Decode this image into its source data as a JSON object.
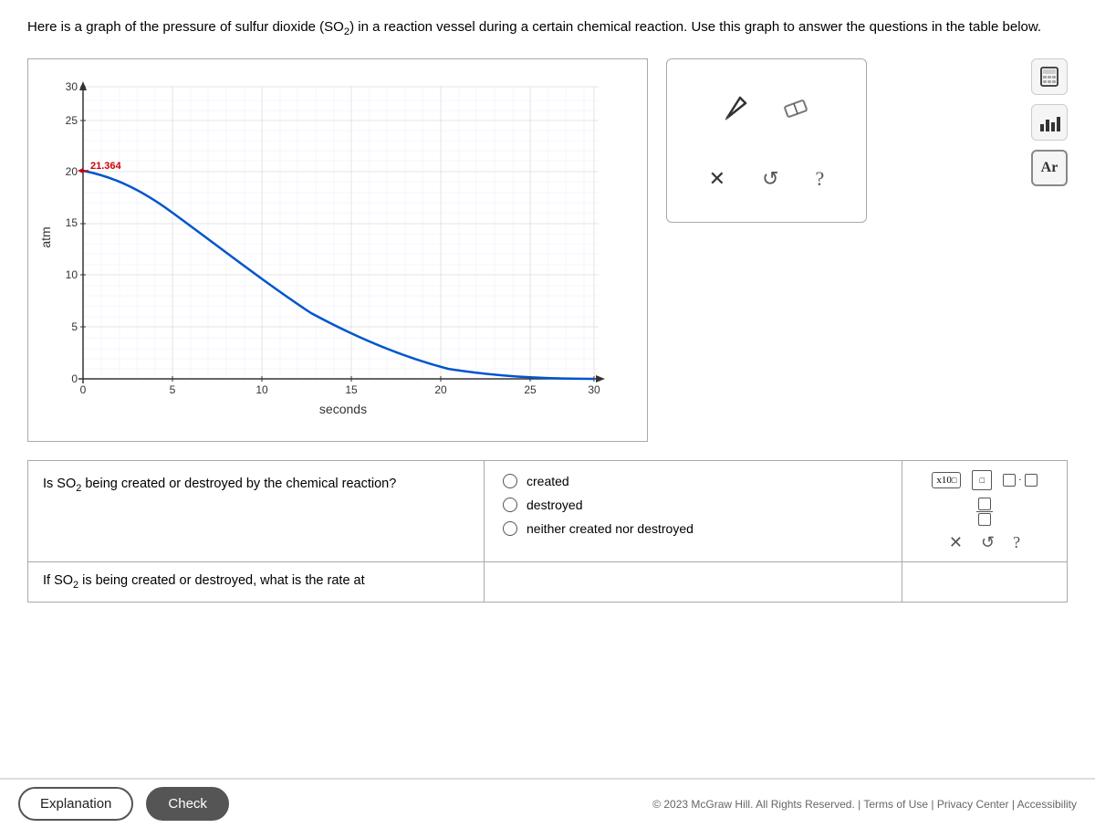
{
  "intro": {
    "text_before": "Here is a graph of the pressure of sulfur dioxide ",
    "chemical": "(SO₂)",
    "text_after": " in a reaction vessel during a certain chemical reaction. Use this graph to answer the questions in the table below."
  },
  "graph": {
    "y_label": "atm",
    "x_label": "seconds",
    "y_axis_values": [
      0,
      5,
      10,
      15,
      20,
      25,
      30
    ],
    "x_axis_values": [
      0,
      5,
      10,
      15,
      20,
      25,
      30
    ],
    "highlight_value": "21.364",
    "curve_start_y": 21.364,
    "curve_end_y": 0.5
  },
  "tools_panel": {
    "icons": [
      "cursor",
      "eraser"
    ],
    "bottom": [
      "close",
      "undo",
      "help"
    ]
  },
  "sidebar_icons": [
    "calculator",
    "chart",
    "Ar"
  ],
  "table": {
    "row1": {
      "question": "Is SO₂ being created or destroyed by the chemical reaction?",
      "options": [
        "created",
        "destroyed",
        "neither created nor destroyed"
      ]
    },
    "row2": {
      "question": "If SO₂ is being created or destroyed, what is the rate at"
    }
  },
  "mini_tools": {
    "x10_label": "x10",
    "close_label": "×",
    "undo_label": "↺",
    "help_label": "?"
  },
  "bottom_bar": {
    "explanation_label": "Explanation",
    "check_label": "Check"
  },
  "footer": {
    "text": "© 2023 McGraw Hill. All Rights Reserved. | Terms of Use | Privacy Center | Accessibility"
  }
}
